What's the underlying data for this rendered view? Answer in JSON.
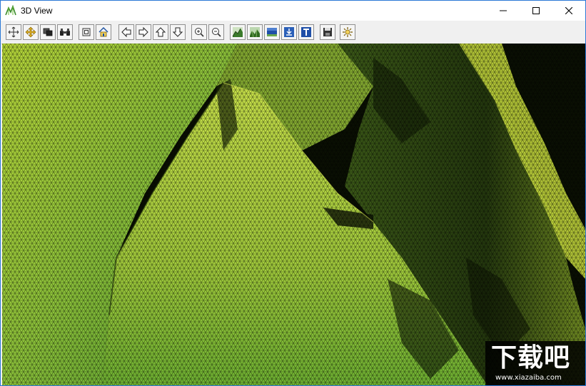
{
  "window": {
    "title": "3D View",
    "icon": "terrain-icon"
  },
  "window_controls": [
    {
      "name": "minimize-button",
      "icon": "minimize-icon"
    },
    {
      "name": "maximize-button",
      "icon": "maximize-icon"
    },
    {
      "name": "close-button",
      "icon": "close-icon"
    }
  ],
  "toolbar": {
    "buttons": [
      {
        "icon": "rotate-icon"
      },
      {
        "icon": "pan-icon"
      },
      {
        "icon": "layers-icon"
      },
      {
        "icon": "binoculars-icon"
      },
      {
        "icon": "zoom-extent-icon"
      },
      {
        "icon": "home-icon"
      },
      {
        "icon": "arrow-left-icon"
      },
      {
        "icon": "arrow-right-icon"
      },
      {
        "icon": "arrow-up-icon"
      },
      {
        "icon": "arrow-down-icon"
      },
      {
        "icon": "zoom-in-icon"
      },
      {
        "icon": "zoom-out-icon"
      },
      {
        "icon": "wireframe-view-icon"
      },
      {
        "icon": "shaded-view-icon"
      },
      {
        "icon": "surface-view-icon"
      },
      {
        "icon": "import-icon"
      },
      {
        "icon": "texture-icon"
      },
      {
        "icon": "save-icon"
      },
      {
        "icon": "settings-icon"
      }
    ]
  },
  "viewport": {
    "content": "wireframe-terrain",
    "colors": {
      "mesh_bright": "#d7f24a",
      "mesh_mid": "#7fc23a",
      "mesh_dark": "#3f6a1a",
      "background": "#000000"
    }
  },
  "watermark": {
    "logo_text": "下载吧",
    "url": "www.xiazaiba.com"
  }
}
